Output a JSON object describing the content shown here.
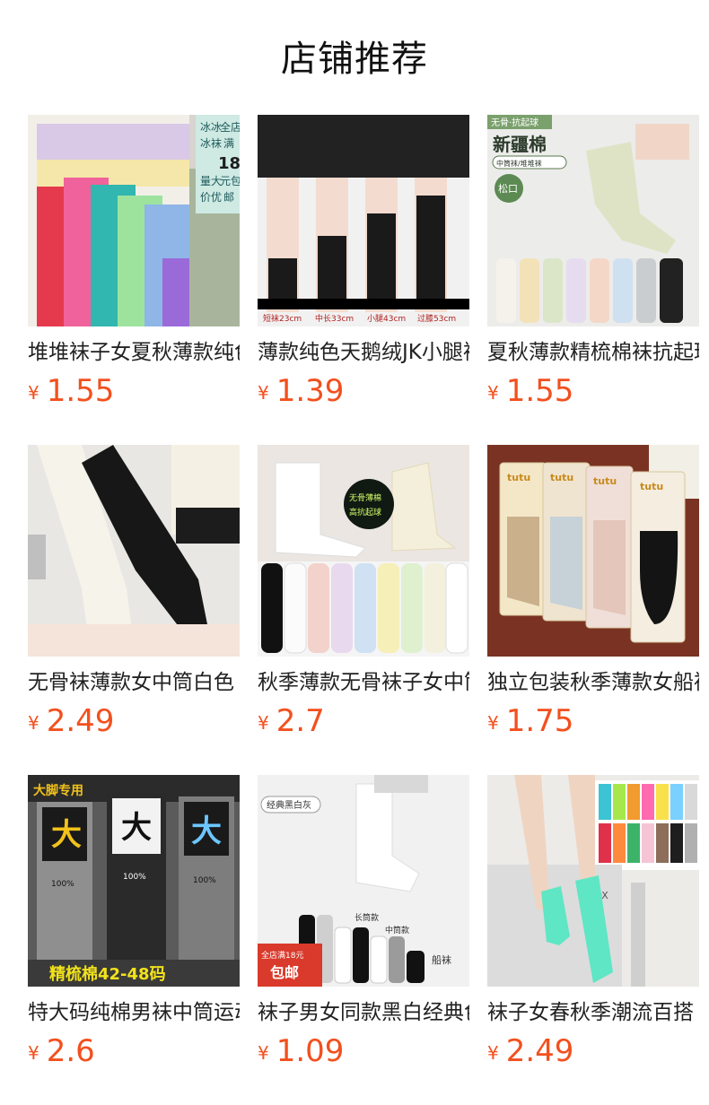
{
  "page_title": "店铺推荐",
  "currency_symbol": "¥",
  "products": [
    {
      "name": "堆堆袜子女夏秋薄款纯色",
      "price": "1.55",
      "image_text": [
        "冰冰",
        "全店",
        "冰袜",
        "满",
        "18",
        "量大",
        "元包",
        "价优",
        "邮"
      ]
    },
    {
      "name": "薄款纯色天鹅绒JK小腿袜",
      "price": "1.39",
      "image_text": [
        "短袜23cm",
        "中长33cm",
        "小腿43cm",
        "过膝53cm"
      ]
    },
    {
      "name": "夏秋薄款精梳棉袜抗起球",
      "price": "1.55",
      "image_text": [
        "无骨·抗起球",
        "新疆棉",
        "中筒袜/堆堆袜",
        "松口"
      ]
    },
    {
      "name": "无骨袜薄款女中筒白色",
      "price": "2.49",
      "image_text": []
    },
    {
      "name": "秋季薄款无骨袜子女中筒",
      "price": "2.7",
      "image_text": [
        "无骨薄棉",
        "高抗起球"
      ]
    },
    {
      "name": "独立包装秋季薄款女船袜",
      "price": "1.75",
      "image_text": [
        "tutu",
        "tutu",
        "tutu",
        "tutu"
      ]
    },
    {
      "name": "特大码纯棉男袜中筒运动",
      "price": "2.6",
      "image_text": [
        "大脚专用",
        "大",
        "大",
        "大",
        "100%",
        "100%",
        "100%",
        "精梳棉42-48码"
      ]
    },
    {
      "name": "袜子男女同款黑白经典色",
      "price": "1.09",
      "image_text": [
        "经典黑白灰",
        "长筒款",
        "中筒款",
        "船袜",
        "全店满18元",
        "包邮"
      ]
    },
    {
      "name": "袜子女春秋季潮流百搭",
      "price": "2.49",
      "image_text": [
        "BOX"
      ]
    }
  ]
}
